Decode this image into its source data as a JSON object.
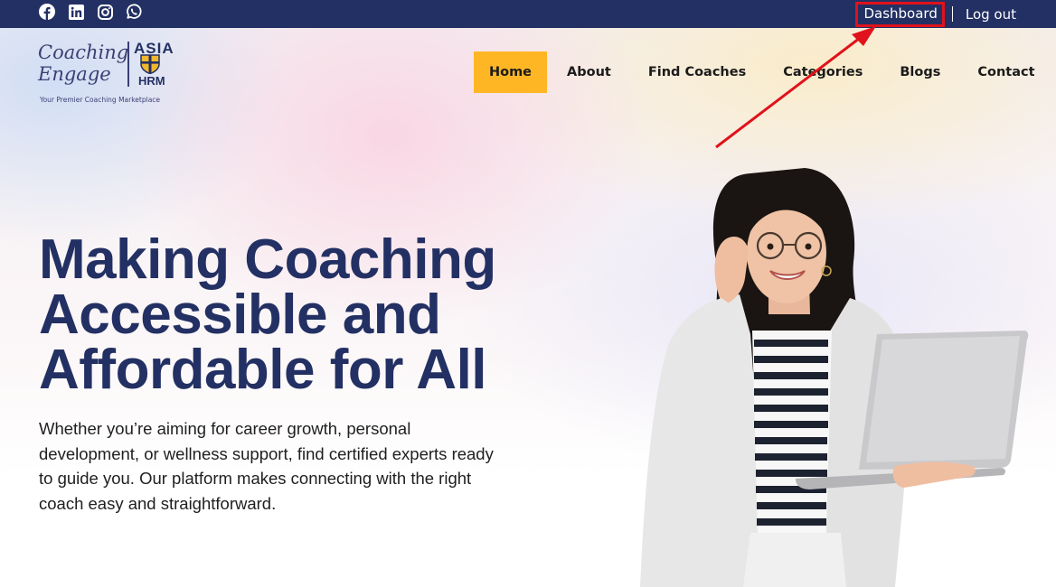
{
  "topbar": {
    "social_icons": [
      "facebook-icon",
      "linkedin-icon",
      "instagram-icon",
      "whatsapp-icon"
    ],
    "dashboard_label": "Dashboard",
    "logout_label": "Log out",
    "background_color": "#233063",
    "highlight_color": "#e0121b"
  },
  "logo": {
    "line1": "Coaching",
    "line2": "Engage",
    "brand": "ASIA",
    "brand_sub": "HRM",
    "tagline": "Your Premier Coaching Marketplace"
  },
  "nav": {
    "items": [
      {
        "label": "Home",
        "active": true
      },
      {
        "label": "About"
      },
      {
        "label": "Find Coaches"
      },
      {
        "label": "Categories"
      },
      {
        "label": "Blogs"
      },
      {
        "label": "Contact"
      }
    ],
    "active_color": "#ffb624"
  },
  "hero": {
    "headline": "Making Coaching Accessible and Affordable for All",
    "description": "Whether you’re aiming for career growth, personal development, or wellness support, find certified experts ready to guide you. Our platform makes connecting with the right coach easy and straightforward.",
    "headline_color": "#233063"
  }
}
